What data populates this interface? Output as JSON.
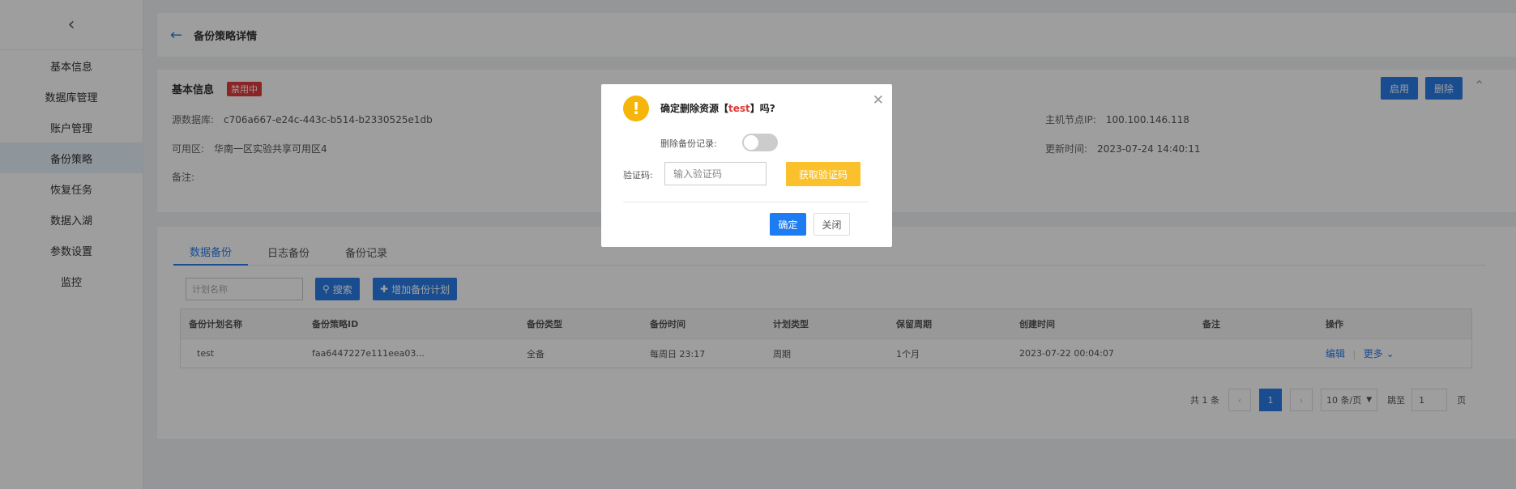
{
  "sidebar": {
    "collapse_icon": "chevron-left-icon",
    "items": [
      {
        "label": "基本信息"
      },
      {
        "label": "数据库管理"
      },
      {
        "label": "账户管理"
      },
      {
        "label": "备份策略"
      },
      {
        "label": "恢复任务"
      },
      {
        "label": "数据入湖"
      },
      {
        "label": "参数设置"
      },
      {
        "label": "监控"
      }
    ]
  },
  "header": {
    "back_icon": "arrow-left-icon",
    "title": "备份策略详情"
  },
  "basic": {
    "title": "基本信息",
    "status_badge": "禁用中",
    "fields": {
      "source_db_label": "源数据库:",
      "source_db_value": "c706a667-e24c-443c-b514-b2330525e1db",
      "zone_label": "可用区:",
      "zone_value": "华南一区实验共享可用区4",
      "remark_label": "备注:",
      "host_ip_label": "主机节点IP:",
      "host_ip_value": "100.100.146.118",
      "update_time_label": "更新时间:",
      "update_time_value": "2023-07-24 14:40:11"
    },
    "enable_label": "启用",
    "delete_label": "删除"
  },
  "tabs": {
    "items": [
      {
        "label": "数据备份"
      },
      {
        "label": "日志备份"
      },
      {
        "label": "备份记录"
      }
    ]
  },
  "toolbar": {
    "search_placeholder": "计划名称",
    "search_label": "搜索",
    "add_label": "增加备份计划"
  },
  "table": {
    "headers": [
      "备份计划名称",
      "备份策略ID",
      "备份类型",
      "备份时间",
      "计划类型",
      "保留周期",
      "创建时间",
      "备注",
      "操作"
    ],
    "rows": [
      [
        "test",
        "faa6447227e111eea03...",
        "全备",
        "每周日 23:17",
        "周期",
        "1个月",
        "2023-07-22 00:04:07",
        ""
      ]
    ],
    "edit_label": "编辑",
    "separator": "|",
    "more_label": "更多"
  },
  "pagination": {
    "total_text": "共 1 条",
    "current_page": "1",
    "page_size": "10 条/页",
    "goto_label": "跳至",
    "goto_value": "1",
    "page_unit": "页"
  },
  "dialog": {
    "title_prefix": "确定删除资源【",
    "title_name": "test",
    "title_suffix": "】吗?",
    "delete_records_label": "删除备份记录:",
    "code_label": "验证码:",
    "code_placeholder": "输入验证码",
    "get_code_label": "获取验证码",
    "confirm_label": "确定",
    "close_label": "关闭"
  }
}
